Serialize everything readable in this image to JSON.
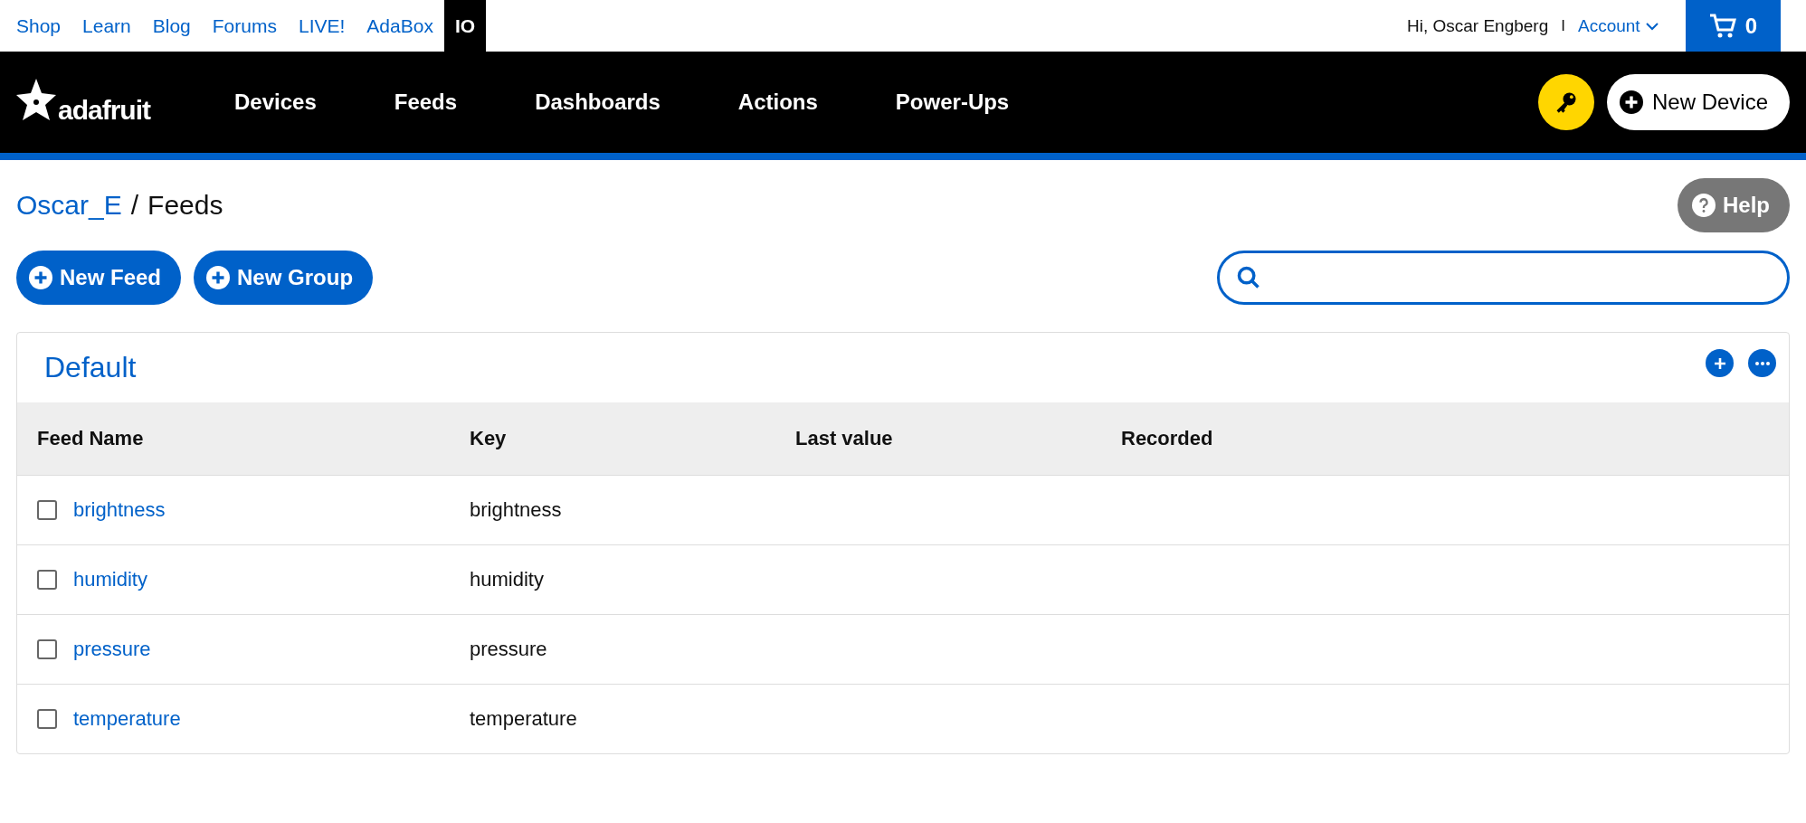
{
  "top_links": [
    {
      "label": "Shop",
      "selected": false
    },
    {
      "label": "Learn",
      "selected": false
    },
    {
      "label": "Blog",
      "selected": false
    },
    {
      "label": "Forums",
      "selected": false
    },
    {
      "label": "LIVE!",
      "selected": false
    },
    {
      "label": "AdaBox",
      "selected": false
    },
    {
      "label": "IO",
      "selected": true
    }
  ],
  "user": {
    "greeting": "Hi, Oscar Engberg",
    "separator": "I",
    "account": "Account",
    "cart_count": "0"
  },
  "nav": {
    "logo": "adafruit",
    "items": [
      "Devices",
      "Feeds",
      "Dashboards",
      "Actions",
      "Power-Ups"
    ],
    "new_device": "New Device"
  },
  "breadcrumb": {
    "user": "Oscar_E",
    "separator": "/",
    "page": "Feeds"
  },
  "help": "Help",
  "actions": [
    "New Feed",
    "New Group"
  ],
  "group": {
    "title": "Default",
    "columns": [
      "Feed Name",
      "Key",
      "Last value",
      "Recorded"
    ],
    "rows": [
      {
        "name": "brightness",
        "key": "brightness",
        "checked": false
      },
      {
        "name": "humidity",
        "key": "humidity",
        "checked": false
      },
      {
        "name": "pressure",
        "key": "pressure",
        "checked": false
      },
      {
        "name": "temperature",
        "key": "temperature",
        "checked": false
      }
    ]
  }
}
